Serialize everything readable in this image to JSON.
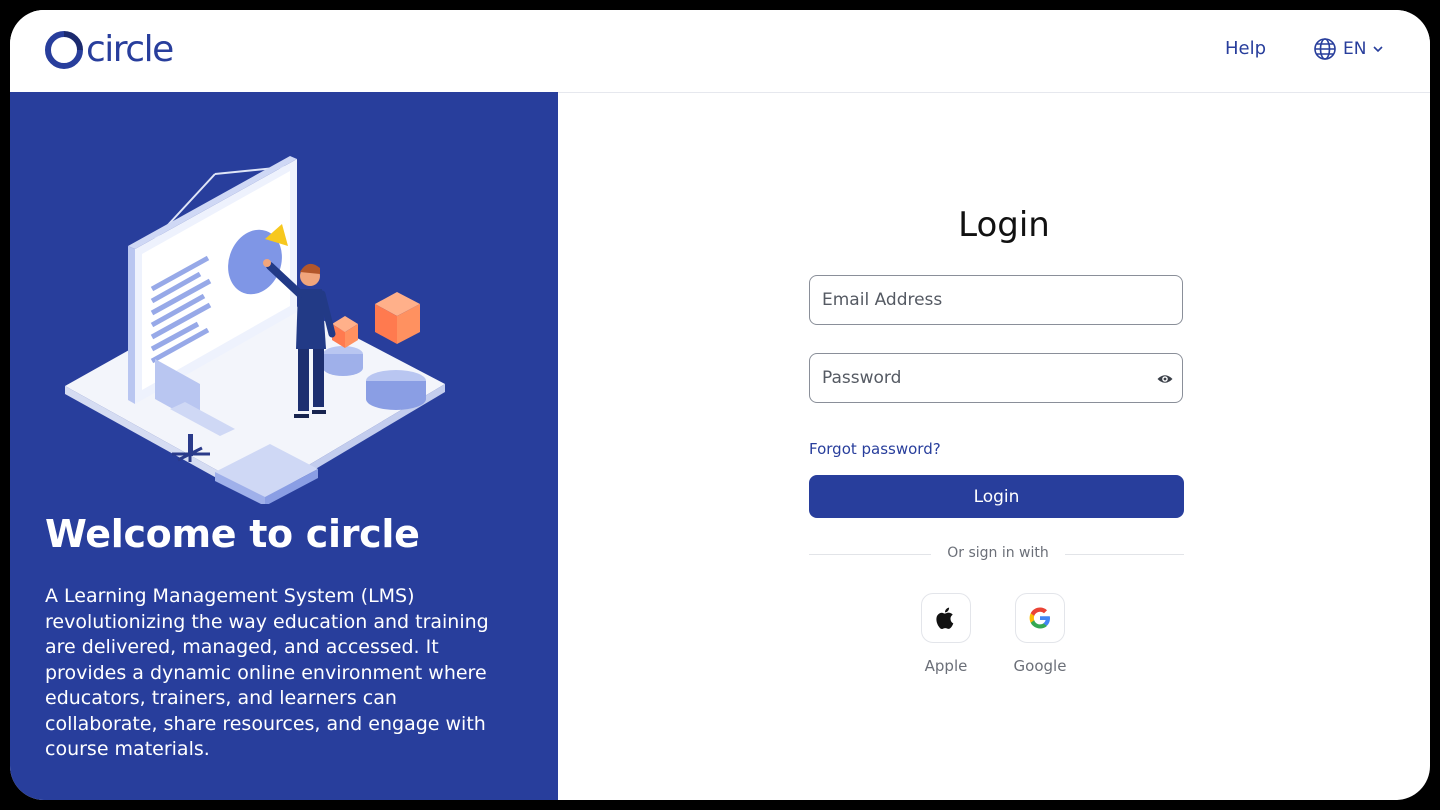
{
  "header": {
    "logo_text": "circle",
    "help_label": "Help",
    "language": {
      "code": "EN",
      "icon": "globe-icon"
    }
  },
  "left_panel": {
    "welcome_title": "Welcome to circle",
    "description": "A Learning Management System (LMS) revolutionizing the way education and training are delivered, managed, and accessed. It provides a dynamic online environment where educators, trainers, and learners can collaborate, share resources, and engage with course materials."
  },
  "login_form": {
    "title": "Login",
    "email_placeholder": "Email Address",
    "password_placeholder": "Password",
    "forgot_label": "Forgot password?",
    "submit_label": "Login",
    "divider_text": "Or sign in with",
    "social": [
      {
        "label": "Apple",
        "icon": "apple-icon"
      },
      {
        "label": "Google",
        "icon": "google-icon"
      }
    ]
  },
  "colors": {
    "brand": "#283e9c",
    "panel_bg": "#283e9c",
    "text_muted": "#6b6f78"
  }
}
